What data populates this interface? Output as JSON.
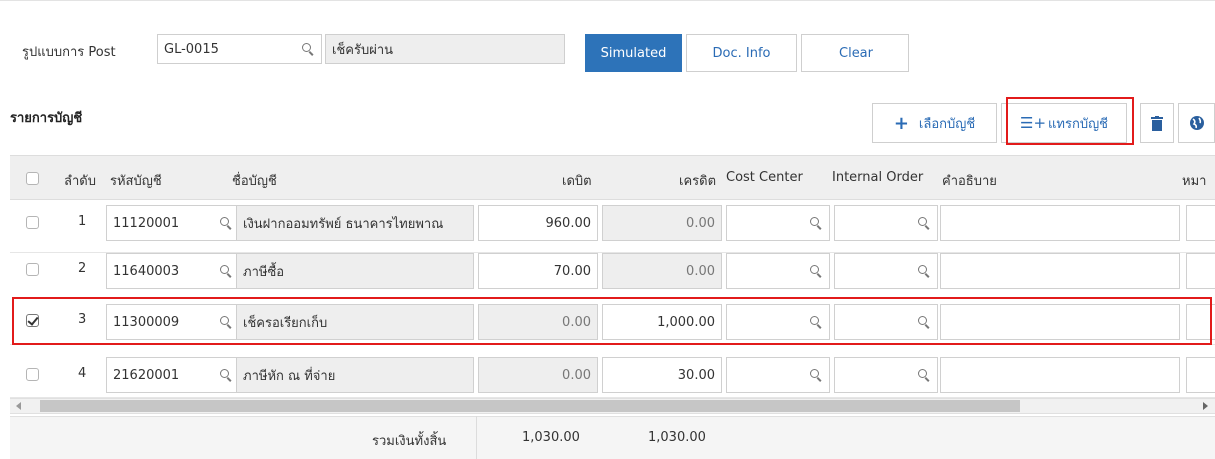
{
  "header": {
    "post_label": "รูปแบบการ Post",
    "post_code": "GL-0015",
    "post_name": "เช็ครับผ่าน",
    "simulated_label": "Simulated",
    "docinfo_label": "Doc. Info",
    "clear_label": "Clear"
  },
  "section": {
    "title": "รายการบัญชี",
    "select_account_label": "เลือกบัญชี",
    "insert_account_label": "แทรกบัญชี"
  },
  "columns": {
    "seq": "ลำดับ",
    "code": "รหัสบัญชี",
    "name": "ชื่อบัญชี",
    "debit": "เดบิต",
    "credit": "เครดิต",
    "cost_center": "Cost Center",
    "internal_order": "Internal Order",
    "description": "คำอธิบาย",
    "remark": "หมา"
  },
  "rows": [
    {
      "seq": "1",
      "code": "11120001",
      "name": "เงินฝากออมทรัพย์ ธนาคารไทยพาณ",
      "debit": "960.00",
      "credit": "0.00",
      "checked": false
    },
    {
      "seq": "2",
      "code": "11640003",
      "name": "ภาษีซื้อ",
      "debit": "70.00",
      "credit": "0.00",
      "checked": false
    },
    {
      "seq": "3",
      "code": "11300009",
      "name": "เช็ครอเรียกเก็บ",
      "debit": "0.00",
      "credit": "1,000.00",
      "checked": true
    },
    {
      "seq": "4",
      "code": "21620001",
      "name": "ภาษีหัก ณ ที่จ่าย",
      "debit": "0.00",
      "credit": "30.00",
      "checked": false
    }
  ],
  "footer": {
    "total_label": "รวมเงินทั้งสิ้น",
    "total_debit": "1,030.00",
    "total_credit": "1,030.00"
  },
  "colors": {
    "primary": "#2d73b9",
    "highlight": "#e21b1b"
  }
}
